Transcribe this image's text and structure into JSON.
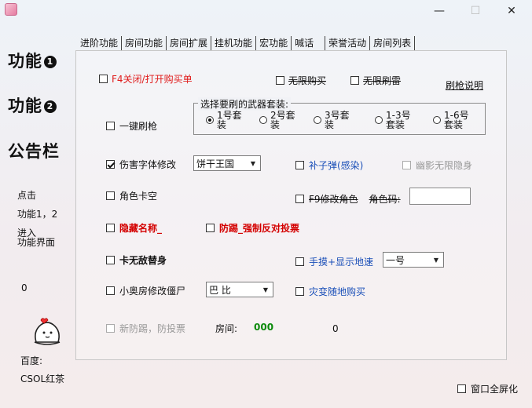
{
  "titlebar": {
    "minimize_glyph": "—",
    "maximize_glyph": "☐",
    "close_glyph": "✕"
  },
  "sidebar": {
    "feature1_label": "功能",
    "feature1_badge": "1",
    "feature2_label": "功能",
    "feature2_badge": "2",
    "notice_label": "公告栏",
    "hint_line1": "点击",
    "hint_line2": "功能1，2",
    "hint_line3": "进入",
    "hint_line4": "功能界面",
    "counter": "0",
    "baidu_label": "百度:",
    "baidu_value": "CSOL红茶"
  },
  "tabs": [
    {
      "label": "进阶功能"
    },
    {
      "label": "房间功能"
    },
    {
      "label": "房间扩展"
    },
    {
      "label": "挂机功能"
    },
    {
      "label": "宏功能"
    },
    {
      "label": "喊话"
    },
    {
      "label": "荣誉活动"
    },
    {
      "label": "房间列表"
    }
  ],
  "main": {
    "f4_toggle": "F4关闭/打开购买单",
    "unlimited_buy": "无限购买",
    "unlimited_grenade": "无限刷雷",
    "refresh_help": "刷枪说明",
    "weapon_group_title": "选择要刷的武器套装:",
    "weapon_sets": [
      {
        "line1": "1号套",
        "line2": "装",
        "selected": true
      },
      {
        "line1": "2号套",
        "line2": "装",
        "selected": false
      },
      {
        "line1": "3号套",
        "line2": "装",
        "selected": false
      },
      {
        "line1": "1-3号",
        "line2": "套装",
        "selected": false
      },
      {
        "line1": "1-6号",
        "line2": "套装",
        "selected": false
      }
    ],
    "one_click_refresh": "一键刷枪",
    "damage_font": "伤害字体修改",
    "damage_font_value": "饼干王国",
    "supplement_infect": "补子弹(感染)",
    "ghost_invisible": "幽影无限隐身",
    "role_freeze": "角色卡空",
    "f9_role": "F9修改角色",
    "role_code_label": "角色码:",
    "role_code_value": "",
    "hide_name": "隐藏名称_",
    "anti_kick": "防踢_强制反对投票",
    "card_invincible": "卡无敌替身",
    "handcuff_speed": "手摸+显示地速",
    "handcuff_value": "一号",
    "small_room_zombie": "小奥房修改僵尸",
    "small_room_value": "巴 比",
    "disaster_buy": "灾变随地购买",
    "new_anti_kick": "新防踢，防投票",
    "room_label": "房间:",
    "room_value": "000",
    "room_count": "0"
  },
  "footer": {
    "fullscreen": "窗口全屏化"
  }
}
